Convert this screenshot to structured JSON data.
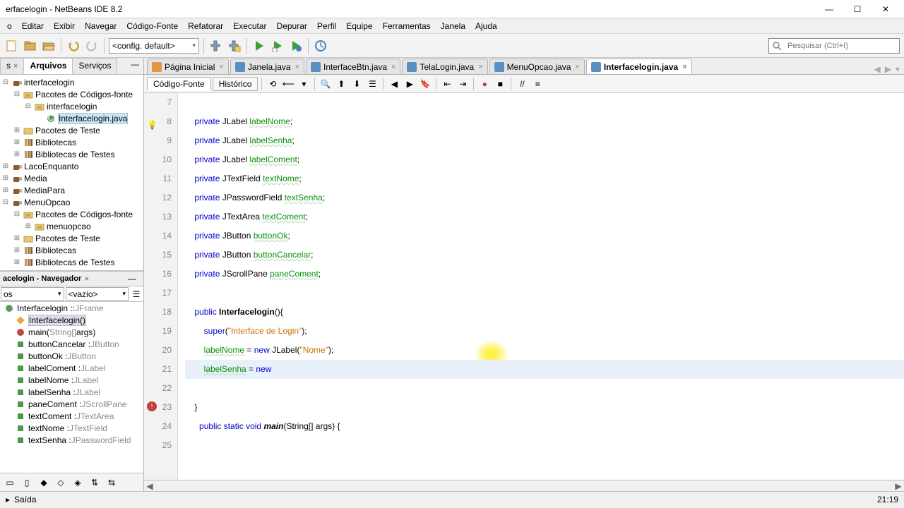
{
  "title": "erfacelogin - NetBeans IDE 8.2",
  "menus": [
    "o",
    "Editar",
    "Exibir",
    "Navegar",
    "Código-Fonte",
    "Refatorar",
    "Executar",
    "Depurar",
    "Perfil",
    "Equipe",
    "Ferramentas",
    "Janela",
    "Ajuda"
  ],
  "config_combo": "<config. default>",
  "search_placeholder": "Pesquisar (Ctrl+I)",
  "panel_tabs": {
    "projects_close": "s",
    "arquivos": "Arquivos",
    "servicos": "Serviços"
  },
  "project_tree": [
    {
      "ind": 0,
      "exp": "−",
      "icon": "coffee",
      "label": "interfacelogin"
    },
    {
      "ind": 1,
      "exp": "−",
      "icon": "pkg",
      "label": "Pacotes de Códigos-fonte"
    },
    {
      "ind": 2,
      "exp": "−",
      "icon": "pkg",
      "label": "interfacelogin"
    },
    {
      "ind": 3,
      "exp": "",
      "icon": "class",
      "label": "Interfacelogin.java",
      "sel": true
    },
    {
      "ind": 1,
      "exp": "+",
      "icon": "folder",
      "label": "Pacotes de Teste"
    },
    {
      "ind": 1,
      "exp": "+",
      "icon": "lib",
      "label": "Bibliotecas"
    },
    {
      "ind": 1,
      "exp": "+",
      "icon": "lib",
      "label": "Bibliotecas de Testes"
    },
    {
      "ind": 0,
      "exp": "+",
      "icon": "coffee",
      "label": "LacoEnquanto"
    },
    {
      "ind": 0,
      "exp": "+",
      "icon": "coffee",
      "label": "Media"
    },
    {
      "ind": 0,
      "exp": "+",
      "icon": "coffee",
      "label": "MediaPara"
    },
    {
      "ind": 0,
      "exp": "−",
      "icon": "coffee",
      "label": "MenuOpcao"
    },
    {
      "ind": 1,
      "exp": "−",
      "icon": "pkg",
      "label": "Pacotes de Códigos-fonte"
    },
    {
      "ind": 2,
      "exp": "+",
      "icon": "pkg",
      "label": "menuopcao"
    },
    {
      "ind": 1,
      "exp": "+",
      "icon": "folder",
      "label": "Pacotes de Teste"
    },
    {
      "ind": 1,
      "exp": "+",
      "icon": "lib",
      "label": "Bibliotecas"
    },
    {
      "ind": 1,
      "exp": "+",
      "icon": "lib",
      "label": "Bibliotecas de Testes"
    }
  ],
  "navigator": {
    "title": "acelogin - Navegador",
    "filter1": "os",
    "filter2": "<vazio>",
    "items": [
      {
        "icon": "class",
        "name": "Interfacelogin :: ",
        "type": "JFrame",
        "ind": 0
      },
      {
        "icon": "ctor",
        "name": "Interfacelogin()",
        "type": "",
        "ind": 1,
        "sel": true
      },
      {
        "icon": "method",
        "name": "main(",
        "arg": "String[]",
        "rest": " args)",
        "type": "",
        "ind": 1
      },
      {
        "icon": "field",
        "name": "buttonCancelar : ",
        "type": "JButton",
        "ind": 1
      },
      {
        "icon": "field",
        "name": "buttonOk : ",
        "type": "JButton",
        "ind": 1
      },
      {
        "icon": "field",
        "name": "labelComent : ",
        "type": "JLabel",
        "ind": 1
      },
      {
        "icon": "field",
        "name": "labelNome : ",
        "type": "JLabel",
        "ind": 1
      },
      {
        "icon": "field",
        "name": "labelSenha : ",
        "type": "JLabel",
        "ind": 1
      },
      {
        "icon": "field",
        "name": "paneComent : ",
        "type": "JScrollPane",
        "ind": 1
      },
      {
        "icon": "field",
        "name": "textComent : ",
        "type": "JTextArea",
        "ind": 1
      },
      {
        "icon": "field",
        "name": "textNome : ",
        "type": "JTextField",
        "ind": 1
      },
      {
        "icon": "field",
        "name": "textSenha : ",
        "type": "JPasswordField",
        "ind": 1
      }
    ]
  },
  "file_tabs": [
    {
      "label": "Página Inicial",
      "home": true,
      "active": false
    },
    {
      "label": "Janela.java",
      "active": false
    },
    {
      "label": "InterfaceBtn.java",
      "active": false
    },
    {
      "label": "TelaLogin.java",
      "active": false
    },
    {
      "label": "MenuOpcao.java",
      "active": false
    },
    {
      "label": "Interfacelogin.java",
      "active": true
    }
  ],
  "editor_sub": {
    "source": "Código-Fonte",
    "history": "Histórico"
  },
  "gutter_start": 7,
  "code": {
    "l7": "",
    "l8": {
      "pre": "    ",
      "kw": "private",
      "typ": " JLabel ",
      "fld": "labelNome",
      "post": ";"
    },
    "l9": {
      "pre": "    ",
      "kw": "private",
      "typ": " JLabel ",
      "fld": "labelSenha",
      "post": ";"
    },
    "l10": {
      "pre": "    ",
      "kw": "private",
      "typ": " JLabel ",
      "fld": "labelComent",
      "post": ";"
    },
    "l11": {
      "pre": "    ",
      "kw": "private",
      "typ": " JTextField ",
      "fld": "textNome",
      "post": ";"
    },
    "l12": {
      "pre": "    ",
      "kw": "private",
      "typ": " JPasswordField ",
      "fld": "textSenha",
      "post": ";"
    },
    "l13": {
      "pre": "    ",
      "kw": "private",
      "typ": " JTextArea ",
      "fld": "textComent",
      "post": ";"
    },
    "l14": {
      "pre": "    ",
      "kw": "private",
      "typ": " JButton ",
      "fld": "buttonOk",
      "post": ";"
    },
    "l15": {
      "pre": "    ",
      "kw": "private",
      "typ": " JButton ",
      "fld": "buttonCancelar",
      "post": ";"
    },
    "l16": {
      "pre": "    ",
      "kw": "private",
      "typ": " JScrollPane ",
      "fld": "paneComent",
      "post": ";"
    },
    "l17": "",
    "l18": {
      "pre": "    ",
      "kw": "public",
      "name": " Interfacelogin",
      "post": "(){"
    },
    "l19": {
      "pre": "        ",
      "kw": "super",
      "p1": "(",
      "str": "\"Interface de Login\"",
      "p2": ");"
    },
    "l20": {
      "pre": "        ",
      "fld": "labelNome",
      "mid": " = ",
      "kw": "new",
      "typ": " JLabel(",
      "str": "\"Nome\"",
      "post": ");"
    },
    "l21": {
      "pre": "        ",
      "fld": "labelSenha",
      "mid": " = ",
      "kw": "new"
    },
    "l22": "",
    "l23": {
      "pre": "    ",
      "post": "}"
    },
    "l24": {
      "pre": "      ",
      "kw1": "public",
      "sp1": " ",
      "kw2": "static",
      "sp2": " ",
      "kw3": "void",
      "sp3": " ",
      "name": "main",
      "post": "(String[] args) {"
    },
    "l25": ""
  },
  "status": {
    "output": "Saída",
    "pos": "21:19"
  }
}
